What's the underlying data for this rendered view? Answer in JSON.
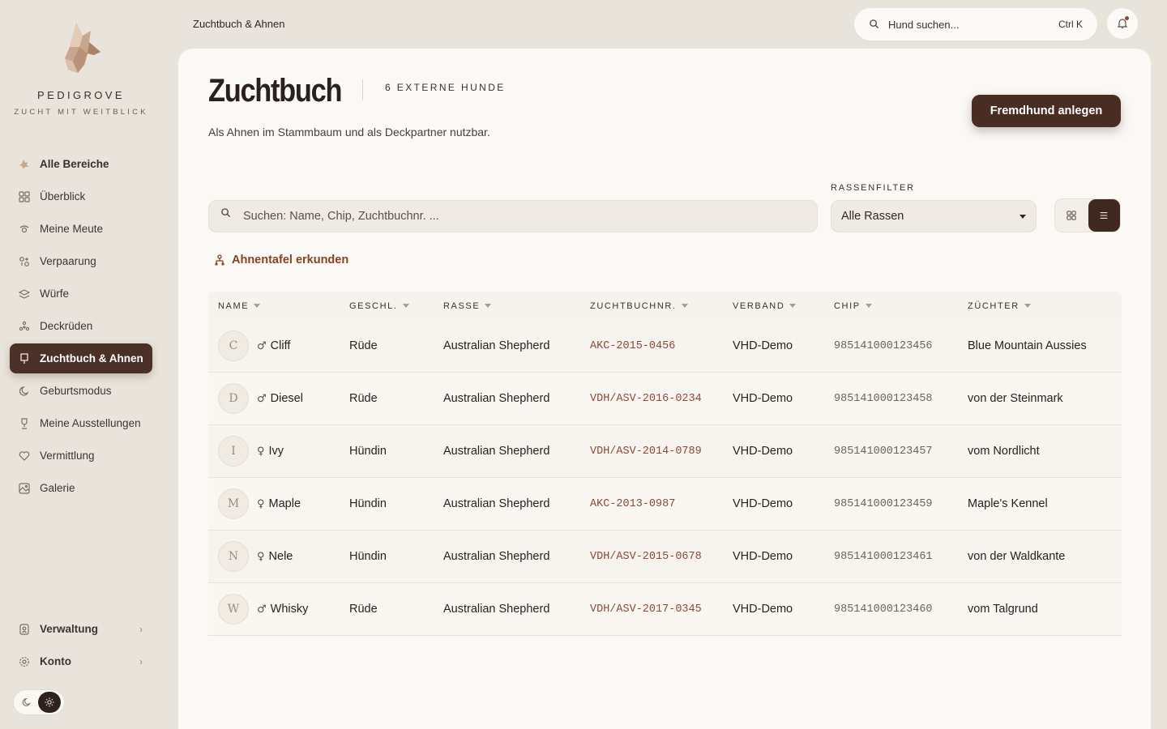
{
  "brand": {
    "name": "PEDIGROVE",
    "tagline": "ZUCHT MIT WEITBLICK"
  },
  "sidebar": {
    "items": [
      {
        "label": "Alle Bereiche",
        "icon": "paw-icon"
      },
      {
        "label": "Überblick",
        "icon": "grid-icon"
      },
      {
        "label": "Meine Meute",
        "icon": "dog-icon"
      },
      {
        "label": "Verpaarung",
        "icon": "link-icon"
      },
      {
        "label": "Würfe",
        "icon": "layers-icon"
      },
      {
        "label": "Deckrüden",
        "icon": "dots-icon"
      },
      {
        "label": "Zuchtbuch & Ahnen",
        "icon": "book-icon",
        "active": true
      },
      {
        "label": "Geburtsmodus",
        "icon": "moon-icon"
      },
      {
        "label": "Meine Ausstellungen",
        "icon": "trophy-icon"
      },
      {
        "label": "Vermittlung",
        "icon": "heart-icon"
      },
      {
        "label": "Galerie",
        "icon": "image-icon"
      }
    ],
    "bottom": [
      {
        "label": "Verwaltung",
        "icon": "badge-icon"
      },
      {
        "label": "Konto",
        "icon": "gear-icon"
      }
    ]
  },
  "topbar": {
    "breadcrumb": "Zuchtbuch & Ahnen",
    "search_placeholder": "Hund suchen...",
    "shortcut": "Ctrl K"
  },
  "page": {
    "title": "Zuchtbuch",
    "count": "6 EXTERNE HUNDE",
    "subtitle": "Als Ahnen im Stammbaum und als Deckpartner nutzbar.",
    "primary_action": "Fremdhund anlegen",
    "search_placeholder": "Suchen: Name, Chip, Zuchtbuchnr. ...",
    "filter_label": "RASSENFILTER",
    "filter_value": "Alle Rassen",
    "pedigree_link": "Ahnentafel erkunden"
  },
  "table": {
    "columns": [
      "NAME",
      "GESCHL.",
      "RASSE",
      "ZUCHTBUCHNR.",
      "VERBAND",
      "CHIP",
      "ZÜCHTER"
    ],
    "rows": [
      {
        "initial": "C",
        "sex_symbol": "♂",
        "name": "Cliff",
        "sex": "Rüde",
        "breed": "Australian Shepherd",
        "number": "AKC-2015-0456",
        "club": "VHD-Demo",
        "chip": "985141000123456",
        "breeder": "Blue Mountain Aussies"
      },
      {
        "initial": "D",
        "sex_symbol": "♂",
        "name": "Diesel",
        "sex": "Rüde",
        "breed": "Australian Shepherd",
        "number": "VDH/ASV-2016-0234",
        "club": "VHD-Demo",
        "chip": "985141000123458",
        "breeder": "von der Steinmark"
      },
      {
        "initial": "I",
        "sex_symbol": "♀",
        "name": "Ivy",
        "sex": "Hündin",
        "breed": "Australian Shepherd",
        "number": "VDH/ASV-2014-0789",
        "club": "VHD-Demo",
        "chip": "985141000123457",
        "breeder": "vom Nordlicht"
      },
      {
        "initial": "M",
        "sex_symbol": "♀",
        "name": "Maple",
        "sex": "Hündin",
        "breed": "Australian Shepherd",
        "number": "AKC-2013-0987",
        "club": "VHD-Demo",
        "chip": "985141000123459",
        "breeder": "Maple's Kennel"
      },
      {
        "initial": "N",
        "sex_symbol": "♀",
        "name": "Nele",
        "sex": "Hündin",
        "breed": "Australian Shepherd",
        "number": "VDH/ASV-2015-0678",
        "club": "VHD-Demo",
        "chip": "985141000123461",
        "breeder": "von der Waldkante"
      },
      {
        "initial": "W",
        "sex_symbol": "♂",
        "name": "Whisky",
        "sex": "Rüde",
        "breed": "Australian Shepherd",
        "number": "VDH/ASV-2017-0345",
        "club": "VHD-Demo",
        "chip": "985141000123460",
        "breeder": "vom Talgrund"
      }
    ]
  },
  "colors": {
    "accent": "#4a2d22",
    "link": "#8a3f22",
    "background": "#e9e4db",
    "card": "#fbf9f5"
  }
}
